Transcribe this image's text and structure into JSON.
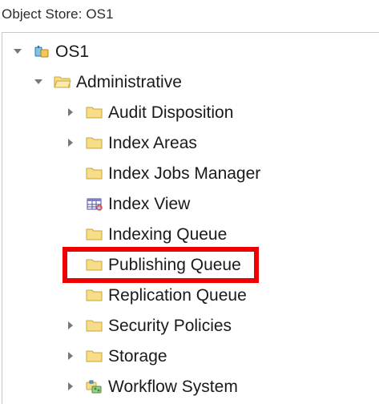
{
  "header": {
    "title": "Object Store: OS1"
  },
  "tree": {
    "root": {
      "label": "OS1",
      "expanded": true,
      "icon": "object-store-icon"
    },
    "admin": {
      "label": "Administrative",
      "expanded": true,
      "icon": "folder-open-icon"
    },
    "items": [
      {
        "label": "Audit Disposition",
        "expandable": true,
        "icon": "folder-icon"
      },
      {
        "label": "Index Areas",
        "expandable": true,
        "icon": "folder-icon"
      },
      {
        "label": "Index Jobs Manager",
        "expandable": false,
        "icon": "folder-icon"
      },
      {
        "label": "Index View",
        "expandable": false,
        "icon": "grid-view-icon"
      },
      {
        "label": "Indexing Queue",
        "expandable": false,
        "icon": "folder-icon"
      },
      {
        "label": "Publishing Queue",
        "expandable": false,
        "icon": "folder-icon",
        "highlighted": true
      },
      {
        "label": "Replication Queue",
        "expandable": false,
        "icon": "folder-icon"
      },
      {
        "label": "Security Policies",
        "expandable": true,
        "icon": "folder-icon"
      },
      {
        "label": "Storage",
        "expandable": true,
        "icon": "folder-icon"
      },
      {
        "label": "Workflow System",
        "expandable": true,
        "icon": "workflow-icon"
      }
    ]
  },
  "colors": {
    "folder": "#f6dd8a",
    "folder_border": "#c9a53a",
    "highlight": "#ee0000",
    "twisty": "#777777"
  }
}
